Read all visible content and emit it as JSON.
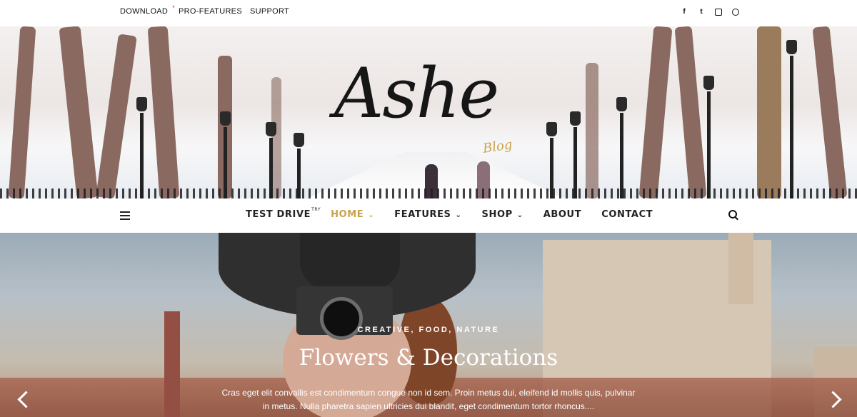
{
  "topbar": {
    "links": [
      "DOWNLOAD",
      "PRO-FEATURES",
      "SUPPORT"
    ],
    "download_marker": "*",
    "social_icons": [
      "facebook-icon",
      "twitter-icon",
      "instagram-icon",
      "pinterest-icon"
    ],
    "social_glyphs": [
      "f",
      "t"
    ]
  },
  "header": {
    "logo": "Ashe",
    "logo_sub": "Blog"
  },
  "nav": {
    "items": [
      {
        "label": "TEST DRIVE",
        "sup": "TRY"
      },
      {
        "label": "HOME",
        "active": true,
        "dropdown": true
      },
      {
        "label": "FEATURES",
        "dropdown": true
      },
      {
        "label": "SHOP",
        "dropdown": true
      },
      {
        "label": "ABOUT"
      },
      {
        "label": "CONTACT"
      }
    ],
    "chevron": "⌄"
  },
  "hero": {
    "categories": "CREATIVE, FOOD, NATURE",
    "title": "Flowers & Decorations",
    "excerpt": "Cras eget elit convallis est condimentum congue non id sem. Proin metus dui, eleifend id mollis quis, pulvinar in metus. Nulla pharetra sapien ultricies dui blandit, eget condimentum tortor rhoncus...."
  },
  "colors": {
    "accent": "#c9a24c",
    "text": "#222222"
  }
}
